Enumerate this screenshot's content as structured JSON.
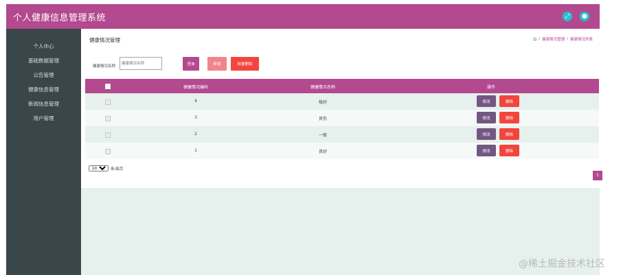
{
  "header": {
    "app_title": "个人健康信息管理系统"
  },
  "sidebar": {
    "items": [
      {
        "label": "个人中心"
      },
      {
        "label": "基础数据管理"
      },
      {
        "label": "公告管理"
      },
      {
        "label": "健康信息管理"
      },
      {
        "label": "新闻信息管理"
      },
      {
        "label": "用户管理"
      }
    ]
  },
  "main": {
    "page_title": "健康情况管理",
    "breadcrumb": [
      "健康情况管理",
      "健康情况列表"
    ],
    "search": {
      "label": "健康情况名称",
      "placeholder": "健康情况名称"
    },
    "buttons": {
      "query": "查询",
      "add": "新增",
      "batch_delete": "批量删除"
    },
    "table": {
      "columns": [
        "健康情况编码",
        "健康情况名称",
        "操作"
      ],
      "rows": [
        {
          "code": "4",
          "name": "极好"
        },
        {
          "code": "3",
          "name": "良伤"
        },
        {
          "code": "2",
          "name": "一般"
        },
        {
          "code": "1",
          "name": "良好"
        }
      ],
      "row_actions": {
        "edit": "修改",
        "delete": "删除"
      }
    },
    "pagination": {
      "page_size": "10",
      "page_size_suffix": "条/每页",
      "current_page": "1"
    }
  },
  "watermark": "@稀土掘金技术社区",
  "colors": {
    "primary": "#b3498f",
    "sidebar_bg": "#39474a",
    "content_bg": "#e6f1ed",
    "edit_button": "#735783",
    "delete_button": "#f2453d",
    "add_button": "#f0858b",
    "top_icon": "#27c1d0"
  }
}
